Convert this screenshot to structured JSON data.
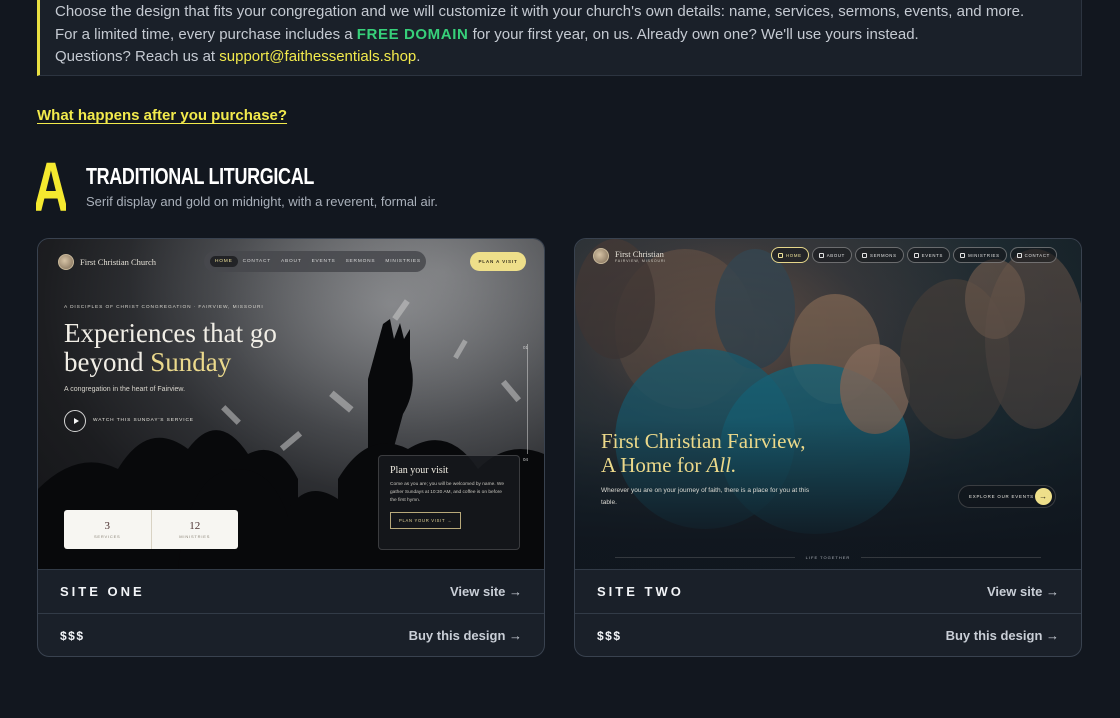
{
  "notice": {
    "line1": "Choose the design that fits your congregation and we will customize it with your church's own details: name, services, sermons, events, and more.",
    "line2_before": "For a limited time, every purchase includes a ",
    "line2_highlight": "FREE DOMAIN",
    "line2_after": " for your first year, on us. Already own one? We'll use yours instead.",
    "line3_before": "Questions? Reach us at ",
    "line3_email": "support@faithessentials.shop",
    "line3_after": "."
  },
  "after_purchase_link": "What happens after you purchase?",
  "section": {
    "letter": "A",
    "title": "TRADITIONAL LITURGICAL",
    "subtitle": "Serif display and gold on midnight, with a reverent, formal air."
  },
  "cards": [
    {
      "name": "SITE ONE",
      "view_label": "View site →",
      "price": "$$$",
      "buy_label": "Buy this design →",
      "preview": {
        "logo": "First Christian Church",
        "nav": [
          "HOME",
          "CONTACT",
          "ABOUT",
          "EVENTS",
          "SERMONS",
          "MINISTRIES"
        ],
        "cta": "PLAN A VISIT",
        "eyebrow": "A DISCIPLES OF CHRIST CONGREGATION · FAIRVIEW, MISSOURI",
        "hero_line1": "Experiences that go",
        "hero_line2_plain": "beyond ",
        "hero_line2_gold": "Sunday",
        "subline": "A congregation in the heart of Fairview.",
        "watch": "WATCH THIS SUNDAY'S SERVICE",
        "scroll_top": "01",
        "scroll_bottom": "04",
        "stats": [
          {
            "value": "3",
            "label": "SERVICES"
          },
          {
            "value": "12",
            "label": "MINISTRIES"
          }
        ],
        "visit_title": "Plan your visit",
        "visit_text": "Come as you are; you will be welcomed by name. We gather Sundays at 10:30 AM, and coffee is on before the first hymn.",
        "visit_button": "PLAN YOUR VISIT →"
      }
    },
    {
      "name": "SITE TWO",
      "view_label": "View site →",
      "price": "$$$",
      "buy_label": "Buy this design →",
      "preview": {
        "logo": "First Christian",
        "logo_sub": "FAIRVIEW, MISSOURI",
        "nav": [
          "HOME",
          "ABOUT",
          "SERMONS",
          "EVENTS",
          "MINISTRIES",
          "CONTACT"
        ],
        "hero_line1": "First Christian Fairview,",
        "hero_line2_plain": "A Home for ",
        "hero_line2_italic": "All.",
        "subline": "Wherever you are on your journey of faith, there is a place for you at this table.",
        "explore": "EXPLORE OUR EVENTS",
        "explore_arrow": "→",
        "footer_label": "LIFE TOGETHER"
      }
    }
  ],
  "colors": {
    "background": "#12171f",
    "accent_yellow": "#f2ea4c",
    "accent_green": "#37d07a",
    "gold": "#ebd98c"
  }
}
